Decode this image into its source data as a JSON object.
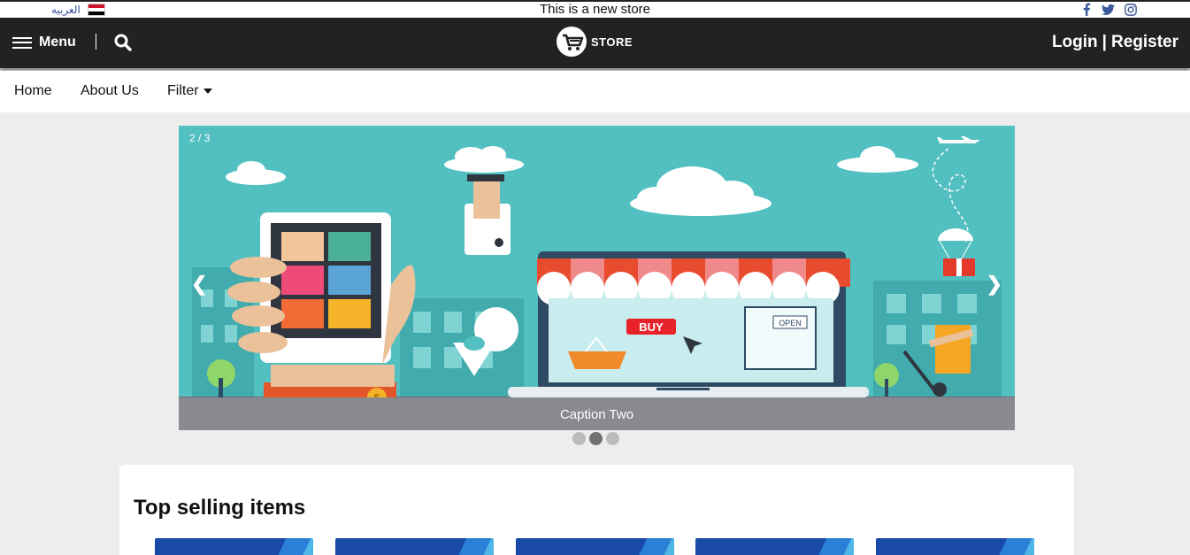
{
  "topbar": {
    "language": "العربيه",
    "announcement": "This is a new store",
    "social_icons": [
      "facebook-icon",
      "twitter-icon",
      "instagram-icon"
    ]
  },
  "header": {
    "menu_label": "Menu",
    "logo_text": "STORE",
    "login_label": "Login",
    "auth_separator": "|",
    "register_label": "Register"
  },
  "nav": {
    "items": [
      {
        "label": "Home"
      },
      {
        "label": "About Us"
      },
      {
        "label": "Filter"
      }
    ]
  },
  "slider": {
    "counter": "2 / 3",
    "caption": "Caption Two",
    "prev_label": "❮",
    "next_label": "❯",
    "scene_texts": {
      "buy": "BUY",
      "open": "OPEN",
      "money": "$"
    },
    "slides_total": 3,
    "active_slide": 2
  },
  "section": {
    "title": "Top selling items",
    "product_count": 5
  },
  "colors": {
    "header_bg": "#222222",
    "slider_bg": "#52bfc0",
    "caption_bg": "#888a90",
    "card_blue": "#1a4aa8"
  }
}
